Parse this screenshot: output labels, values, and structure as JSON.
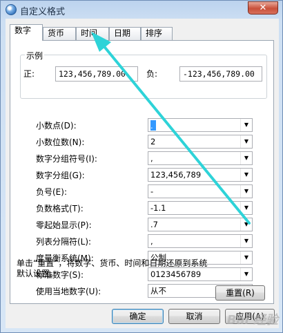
{
  "window": {
    "title": "自定义格式",
    "close_symbol": "✕"
  },
  "tabs": [
    {
      "label": "数字",
      "active": true
    },
    {
      "label": "货币",
      "active": false
    },
    {
      "label": "时间",
      "active": false
    },
    {
      "label": "日期",
      "active": false
    },
    {
      "label": "排序",
      "active": false
    }
  ],
  "example": {
    "title": "示例",
    "positive_label": "正:",
    "positive_value": "123,456,789.00",
    "negative_label": "负:",
    "negative_value": "-123,456,789.00"
  },
  "settings": [
    {
      "label": "小数点(D):",
      "value": "."
    },
    {
      "label": "小数位数(N):",
      "value": "2"
    },
    {
      "label": "数字分组符号(I):",
      "value": ","
    },
    {
      "label": "数字分组(G):",
      "value": "123,456,789"
    },
    {
      "label": "负号(E):",
      "value": "-"
    },
    {
      "label": "负数格式(T):",
      "value": "-1.1"
    },
    {
      "label": "零起始显示(P):",
      "value": ".7"
    },
    {
      "label": "列表分隔符(L):",
      "value": ","
    },
    {
      "label": "度量衡系统(M):",
      "value": "公制"
    },
    {
      "label": "标准数字(S):",
      "value": "0123456789"
    },
    {
      "label": "使用当地数字(U):",
      "value": "从不"
    }
  ],
  "note": "单击“重置”，将数字、货币、时间和日期还原到系统默认设置。",
  "buttons": {
    "reset": "重置(R)",
    "ok": "确定",
    "cancel": "取消",
    "apply": "应用(A)"
  },
  "watermark": "Bai 经验",
  "colors": {
    "arrow": "#2ed3d8",
    "selection": "#3399ff"
  }
}
